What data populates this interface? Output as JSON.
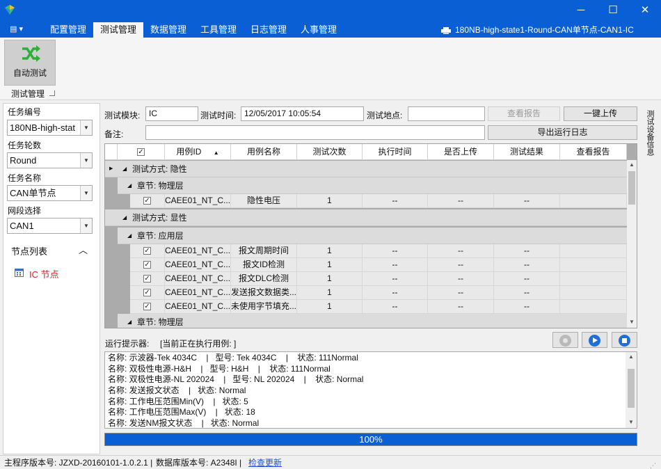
{
  "window": {
    "title": "180NB-high-state1-Round-CAN单节点-CAN1-IC",
    "minimize": "─",
    "maximize": "☐",
    "close": "✕"
  },
  "menu": {
    "app_button": "▤ ▾",
    "tabs": [
      "配置管理",
      "测试管理",
      "数据管理",
      "工具管理",
      "日志管理",
      "人事管理"
    ],
    "active_tab": "测试管理"
  },
  "ribbon": {
    "auto_test_label": "自动测试",
    "group_label": "测试管理"
  },
  "left_panel": {
    "task_no_label": "任务编号",
    "task_no_value": "180NB-high-stat",
    "task_round_label": "任务轮数",
    "task_round_value": "Round",
    "task_name_label": "任务名称",
    "task_name_value": "CAN单节点",
    "segment_label": "网段选择",
    "segment_value": "CAN1",
    "node_list_label": "节点列表",
    "node_list_toggle": "︿",
    "node_item": "IC 节点"
  },
  "form": {
    "module_label": "测试模块:",
    "module_value": "IC",
    "time_label": "测试时间:",
    "time_value": "12/05/2017 10:05:54",
    "location_label": "测试地点:",
    "location_value": "",
    "view_report_btn": "查看报告",
    "upload_btn": "一键上传",
    "remark_label": "备注:",
    "remark_value": "",
    "export_log_btn": "导出运行日志"
  },
  "grid": {
    "columns": [
      "",
      "用例ID",
      "用例名称",
      "测试次数",
      "执行时间",
      "是否上传",
      "测试结果",
      "查看报告"
    ],
    "sort_icon": "▲",
    "groups": [
      {
        "label": "测试方式: 隐性",
        "level": 1
      },
      {
        "label": "章节: 物理层",
        "level": 2
      },
      {
        "row": {
          "checked": true,
          "id": "CAEE01_NT_C...",
          "name": "隐性电压",
          "count": "1",
          "time": "--",
          "uploaded": "--",
          "result": "--",
          "report": ""
        }
      },
      {
        "label": "测试方式: 显性",
        "level": 1
      },
      {
        "label": "章节: 应用层",
        "level": 2
      },
      {
        "row": {
          "checked": true,
          "id": "CAEE01_NT_C...",
          "name": "报文周期时间",
          "count": "1",
          "time": "--",
          "uploaded": "--",
          "result": "--",
          "report": ""
        }
      },
      {
        "row": {
          "checked": true,
          "id": "CAEE01_NT_C...",
          "name": "报文ID检测",
          "count": "1",
          "time": "--",
          "uploaded": "--",
          "result": "--",
          "report": ""
        }
      },
      {
        "row": {
          "checked": true,
          "id": "CAEE01_NT_C...",
          "name": "报文DLC检测",
          "count": "1",
          "time": "--",
          "uploaded": "--",
          "result": "--",
          "report": ""
        }
      },
      {
        "row": {
          "checked": true,
          "id": "CAEE01_NT_C...",
          "name": "发送报文数据类...",
          "count": "1",
          "time": "--",
          "uploaded": "--",
          "result": "--",
          "report": ""
        }
      },
      {
        "row": {
          "checked": true,
          "id": "CAEE01_NT_C...",
          "name": "未使用字节填充...",
          "count": "1",
          "time": "--",
          "uploaded": "--",
          "result": "--",
          "report": ""
        }
      },
      {
        "label": "章节: 物理层",
        "level": 2
      }
    ]
  },
  "run": {
    "prompt_label": "运行提示器:",
    "current_case": "[当前正在执行用例: ]"
  },
  "log_lines": [
    "名称: 示波器-Tek 4034C    |   型号: Tek 4034C    |    状态: 111Normal",
    "名称: 双极性电源-H&H    |   型号: H&H    |    状态: 111Normal",
    "名称: 双极性电源-NL 202024    |   型号: NL 202024    |    状态: Normal",
    "名称: 发送报文状态    |   状态: Normal",
    "名称: 工作电压范围Min(V)    |   状态: 5",
    "名称: 工作电压范围Max(V)    |   状态: 18",
    "名称: 发送NM报文状态    |   状态: Normal"
  ],
  "progress": {
    "percent": 100,
    "label": "100%"
  },
  "right_side_label": "测试设备信息",
  "status": {
    "main_version": "主程序版本号: JZXD-20160101-1.0.2.1  |",
    "db_version": "数据库版本号: A2348I  |",
    "check_update": "检查更新"
  },
  "colors": {
    "accent": "#0a5fd4",
    "node_red": "#e02020",
    "link": "#1f4fd8"
  }
}
